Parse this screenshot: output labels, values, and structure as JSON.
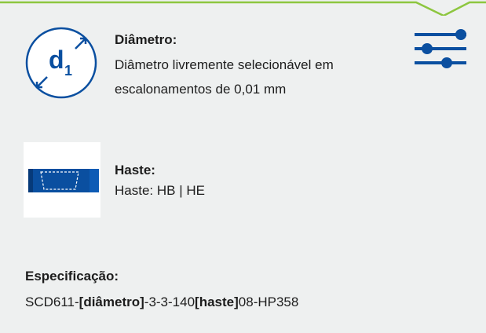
{
  "colors": {
    "accent_green": "#8dc63f",
    "brand_blue": "#0a4fa0",
    "background": "#eef0f0",
    "text": "#1d1d1d"
  },
  "icons": {
    "diameter": "diameter-d1-icon",
    "filter": "sliders-filter-icon",
    "shank": "shank-icon"
  },
  "diameter_icon_text": {
    "letter": "d",
    "subscript": "1"
  },
  "diameter": {
    "title": "Diâmetro:",
    "desc_line1": "Diâmetro livremente selecionável em",
    "desc_line2": "escalonamentos de 0,01 mm"
  },
  "shank": {
    "title": "Haste:",
    "desc": "Haste: HB | HE"
  },
  "specification": {
    "title": "Especificação:",
    "code_prefix": "SCD611-",
    "code_diameter": "[diâmetro]",
    "code_middle": "-3-3-140",
    "code_shank": "[haste]",
    "code_suffix": "08-HP358"
  }
}
